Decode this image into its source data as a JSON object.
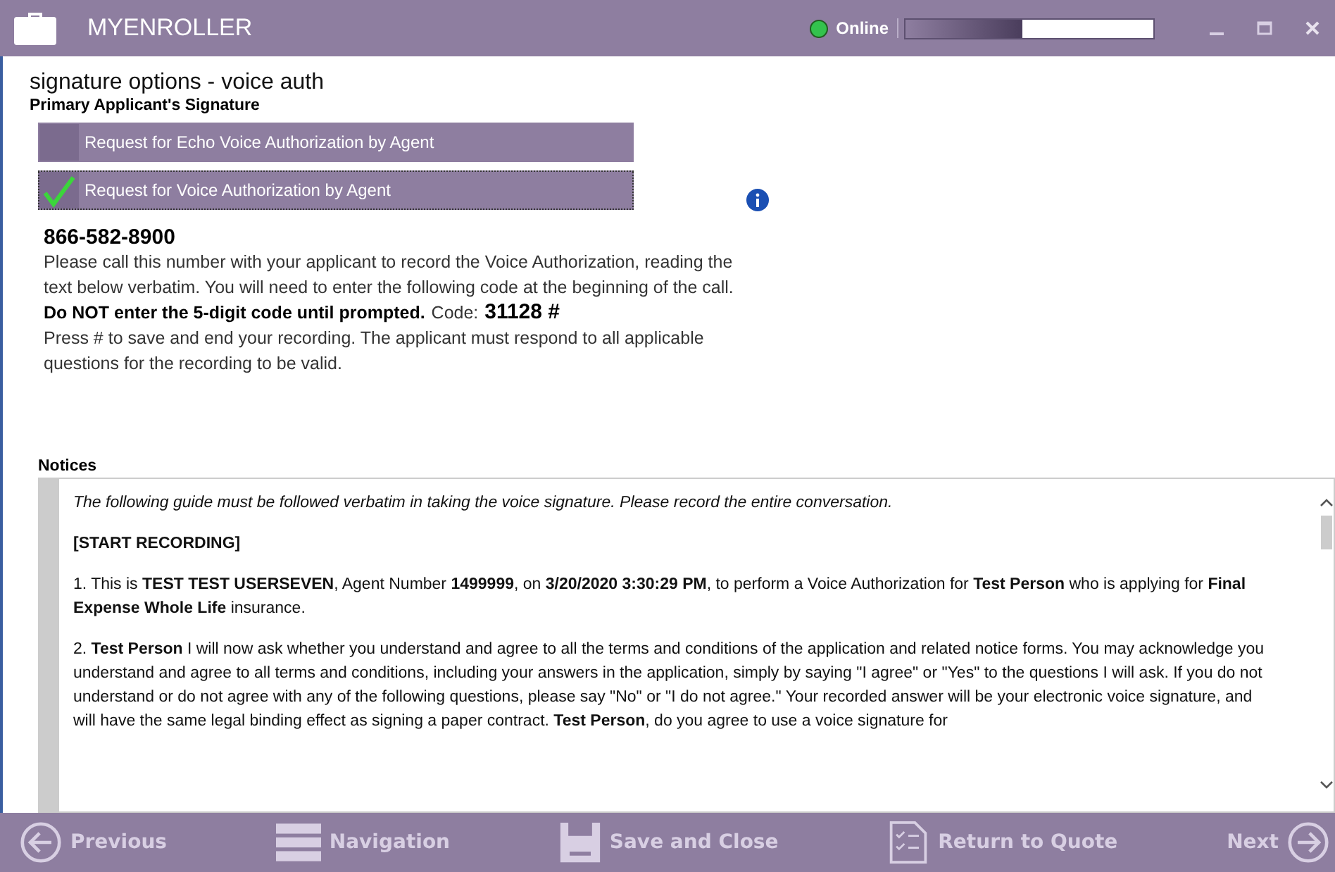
{
  "window": {
    "title": "MYENROLLER",
    "status": "Online",
    "online": true,
    "progress": {
      "level": 0.47
    }
  },
  "page": {
    "title": "signature options - voice auth",
    "subtitle": "Primary Applicant's Signature"
  },
  "options": [
    {
      "label": "Request for Echo Voice Authorization by Agent",
      "selected": false
    },
    {
      "label": "Request for Voice Authorization by Agent",
      "selected": true
    }
  ],
  "instructions": {
    "phone": "866-582-8900",
    "text": "Please call this number with your applicant to record the Voice Authorization, reading the text below verbatim. You will need to enter the following code at the beginning of the call.",
    "warning": "Do NOT enter the 5-digit code until prompted.",
    "code_label": "Code:",
    "code": "31128 #",
    "note": "Press # to save and end your recording. The applicant must respond to all applicable questions for the recording to be valid."
  },
  "notices": {
    "label": "Notices",
    "paragraphs": [
      {
        "kind": "intro",
        "text": "The following guide must be followed verbatim in taking the voice signature. Please record the entire conversation."
      },
      {
        "kind": "heading",
        "text": "[START RECORDING]"
      },
      {
        "kind": "text",
        "text": "1. This is **TEST TEST USERSEVEN**, Agent Number **1499999**, on **3/20/2020 3:30:29 PM**, to perform a Voice Authorization for **Test Person** who is applying for **Final Expense Whole Life** insurance."
      },
      {
        "kind": "text",
        "text": "2. **Test Person** I will now ask whether you understand and agree to all the terms and conditions of the application and related notice forms. You may acknowledge you understand and agree to all terms and conditions, including your answers in the application, simply by saying \"I agree\" or \"Yes\" to the questions I will ask. If you do not understand or do not agree with any of the following questions, please say \"No\" or \"I do not agree.\" Your recorded answer will be your electronic voice signature, and will have the same legal binding effect as signing a paper contract. **Test Person**, do you agree to use a voice signature for"
      }
    ]
  },
  "footer": [
    {
      "label": "Previous"
    },
    {
      "label": "Navigation"
    },
    {
      "label": "Save and Close"
    },
    {
      "label": "Return to Quote"
    },
    {
      "label": "Next"
    }
  ]
}
